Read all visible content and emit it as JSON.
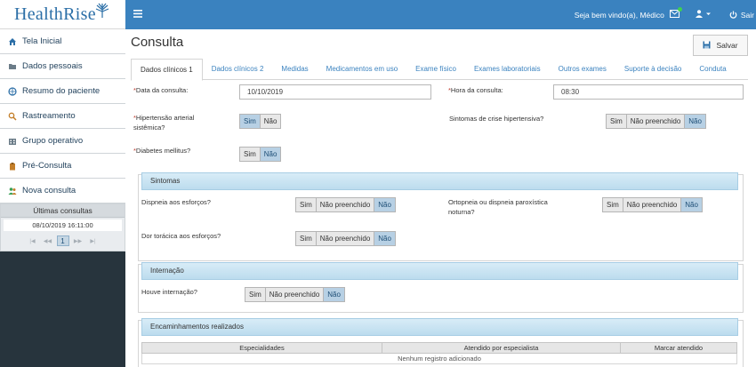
{
  "brand": {
    "name": "HealthRise"
  },
  "sidebar": {
    "items": [
      {
        "label": "Tela Inicial",
        "icon": "home-icon"
      },
      {
        "label": "Dados pessoais",
        "icon": "folder-icon"
      },
      {
        "label": "Resumo do paciente",
        "icon": "globe-icon"
      },
      {
        "label": "Rastreamento",
        "icon": "search-icon"
      },
      {
        "label": "Grupo operativo",
        "icon": "building-icon"
      },
      {
        "label": "Pré-Consulta",
        "icon": "clipboard-icon"
      },
      {
        "label": "Nova consulta",
        "icon": "users-icon"
      }
    ],
    "recent": {
      "title": "Últimas consultas",
      "entries": [
        "08/10/2019 16:11:00"
      ],
      "pager": {
        "first": "|◀",
        "prev": "◀◀",
        "current": "1",
        "next": "▶▶",
        "last": "▶|"
      }
    }
  },
  "topbar": {
    "welcome": "Seja bem vindo(a), Médico",
    "logout": "Sair",
    "accent": "#3a82bf"
  },
  "page": {
    "title": "Consulta",
    "save_label": "Salvar",
    "tabs": [
      {
        "label": "Dados clínicos 1",
        "active": true
      },
      {
        "label": "Dados clínicos 2"
      },
      {
        "label": "Medidas"
      },
      {
        "label": "Medicamentos em uso"
      },
      {
        "label": "Exame físico"
      },
      {
        "label": "Exames laboratoriais"
      },
      {
        "label": "Outros exames"
      },
      {
        "label": "Suporte à decisão"
      },
      {
        "label": "Conduta"
      }
    ]
  },
  "form": {
    "req_mark": "*",
    "data_consulta": {
      "label": "Data da consulta:",
      "value": "10/10/2019"
    },
    "hora_consulta": {
      "label": "Hora da consulta:",
      "value": "08:30"
    },
    "hipertensao": {
      "label_1": "Hipertensão arterial",
      "label_2": "sistêmica?",
      "options": [
        "Sim",
        "Não"
      ],
      "selected": "Sim"
    },
    "sintomas_crise": {
      "label": "Sintomas de crise hipertensiva?",
      "options": [
        "Sim",
        "Não preenchido",
        "Não"
      ],
      "selected": "Não"
    },
    "diabetes": {
      "label": "Diabetes mellitus?",
      "options": [
        "Sim",
        "Não"
      ],
      "selected": "Não"
    },
    "sintomas_section": "Sintomas",
    "dispneia": {
      "label": "Dispneia aos esforços?",
      "options": [
        "Sim",
        "Não preenchido",
        "Não"
      ],
      "selected": "Não"
    },
    "ortopneia": {
      "label_1": "Ortopneia ou dispneia paroxística",
      "label_2": "noturna?",
      "options": [
        "Sim",
        "Não preenchido",
        "Não"
      ],
      "selected": "Não"
    },
    "dor_toracica": {
      "label": "Dor torácica aos esforços?",
      "options": [
        "Sim",
        "Não preenchido",
        "Não"
      ],
      "selected": "Não"
    },
    "internacao_section": "Internação",
    "internacao": {
      "label": "Houve internação?",
      "options": [
        "Sim",
        "Não preenchido",
        "Não"
      ],
      "selected": "Não"
    },
    "encaminhamentos_section": "Encaminhamentos realizados",
    "table": {
      "headers": [
        "Especialidades",
        "Atendido por especialista",
        "Marcar atendido"
      ],
      "empty": "Nenhum registro adicionado"
    }
  }
}
